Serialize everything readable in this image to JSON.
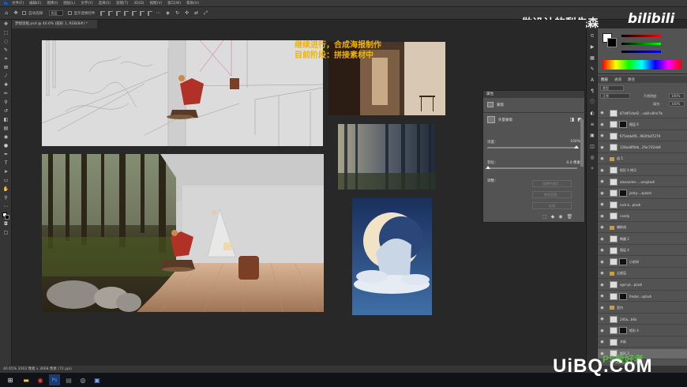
{
  "menu": [
    "文件(F)",
    "编辑(E)",
    "图像(I)",
    "图层(L)",
    "文字(Y)",
    "选择(S)",
    "滤镜(T)",
    "3D(D)",
    "视图(V)",
    "窗口(W)",
    "帮助(H)"
  ],
  "options": {
    "auto_select": "自动选择:",
    "auto_select_value": "图层",
    "show_transform": "显示变换控件"
  },
  "document": {
    "tab": "梦想思抠.psd @ 40.6% (船形 1, RGB/8#) *",
    "status": "40.65%   3563 像素 x 3668 像素 (72 ppi)"
  },
  "canvas_text": {
    "line1": "继续进行，合成海报制作",
    "line2": "目前阶段：拼接素材中"
  },
  "properties": {
    "title": "属性",
    "tab": "蒙版",
    "type": "矢量蒙版",
    "density_label": "浓度：",
    "density_value": "100%",
    "feather_label": "羽化：",
    "feather_value": "0.0 像素",
    "refine_label": "调整：",
    "btn_select": "选择并遮住...",
    "btn_color": "颜色范围...",
    "btn_invert": "反相"
  },
  "watermark": {
    "text": "做设计的梨先森",
    "brand": "bilibili",
    "site": "UiBQ.CoM",
    "site2": "PS爱好者"
  },
  "layers_panel": {
    "tabs": [
      "图层",
      "通道",
      "路径"
    ],
    "kind": "类型",
    "blend": "正常",
    "opacity_label": "不透明度:",
    "opacity": "100%",
    "fill_label": "填充:",
    "fill": "100%",
    "items": [
      {
        "name": "87d4f1dad2....aa8-u0mr7b",
        "type": "layer"
      },
      {
        "name": "图层 6",
        "type": "layer"
      },
      {
        "name": "975ebb4f6...992f4af7279",
        "type": "layer"
      },
      {
        "name": "128aa8f0db...2fac742de8",
        "type": "layer"
      },
      {
        "name": "组 5",
        "type": "group"
      },
      {
        "name": "矩形 4 拷贝",
        "type": "layer"
      },
      {
        "name": "alexandre-....unsplash",
        "type": "layer"
      },
      {
        "name": "jonty-...splash",
        "type": "layer"
      },
      {
        "name": "nick-k...plash",
        "type": "layer"
      },
      {
        "name": "candy",
        "type": "layer"
      },
      {
        "name": "辅助线",
        "type": "group"
      },
      {
        "name": "椭圆 2",
        "type": "layer"
      },
      {
        "name": "图层 4",
        "type": "layer"
      },
      {
        "name": "小房间",
        "type": "layer"
      },
      {
        "name": "过度层",
        "type": "group"
      },
      {
        "name": "sgsi-yk...plash",
        "type": "layer"
      },
      {
        "name": "freder...splash",
        "type": "layer"
      },
      {
        "name": "室内",
        "type": "group"
      },
      {
        "name": "240a...b6a",
        "type": "layer"
      },
      {
        "name": "矩形 4",
        "type": "layer"
      },
      {
        "name": "木板",
        "type": "layer"
      },
      {
        "name": "矩形 3",
        "type": "layer"
      }
    ]
  },
  "colors": {
    "accent": "#f0b400",
    "panel": "#535353",
    "selection": "#c59d4a"
  }
}
